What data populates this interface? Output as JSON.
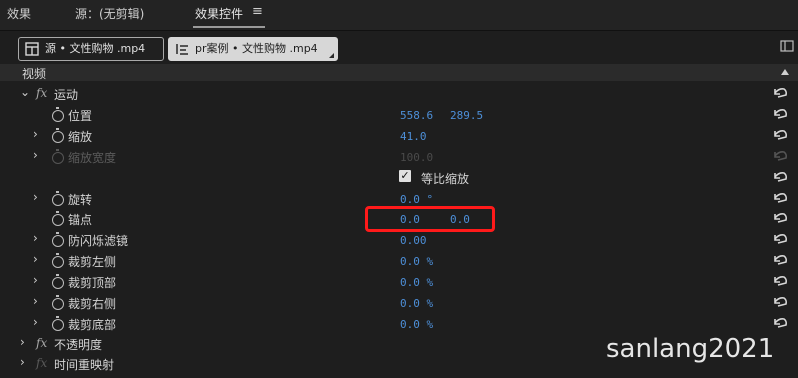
{
  "tabs": {
    "effects": "效果",
    "source": "源：(无剪辑)",
    "effect_controls": "效果控件",
    "menu_icon": "≡"
  },
  "source_bar": {
    "source_label": "源 • 文性购物 .mp4",
    "sequence_label": "pr案例 • 文性购物 .mp4"
  },
  "section": {
    "video": "视频"
  },
  "rows": {
    "motion": "运动",
    "position": {
      "label": "位置",
      "x": "558.6",
      "y": "289.5"
    },
    "scale": {
      "label": "缩放",
      "value": "41.0"
    },
    "scale_width": {
      "label": "缩放宽度",
      "value": "100.0"
    },
    "uniform_scale": {
      "label": "等比缩放",
      "check": "✓"
    },
    "rotation": {
      "label": "旋转",
      "value": "0.0 °"
    },
    "anchor": {
      "label": "锚点",
      "x": "0.0",
      "y": "0.0"
    },
    "antiflicker": {
      "label": "防闪烁滤镜",
      "value": "0.00"
    },
    "crop_left": {
      "label": "裁剪左侧",
      "value": "0.0 %"
    },
    "crop_top": {
      "label": "裁剪顶部",
      "value": "0.0 %"
    },
    "crop_right": {
      "label": "裁剪右侧",
      "value": "0.0 %"
    },
    "crop_bottom": {
      "label": "裁剪底部",
      "value": "0.0 %"
    },
    "opacity": "不透明度",
    "time_remap": "时间重映射"
  },
  "watermark": "sanlang2021",
  "colors": {
    "value_blue": "#4d8fd8",
    "highlight_red": "#ff1a1a"
  }
}
